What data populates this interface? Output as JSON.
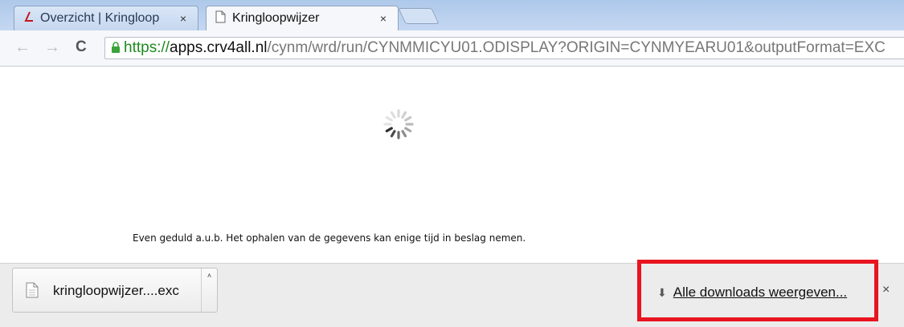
{
  "tabs": [
    {
      "label": "Overzicht | Kringloop",
      "icon": "red-logo-icon",
      "close": "×",
      "active": false
    },
    {
      "label": "Kringloopwijzer",
      "icon": "page-icon",
      "close": "×",
      "active": true
    }
  ],
  "toolbar": {
    "back": "←",
    "forward": "→",
    "reload": "C",
    "url": {
      "scheme": "https://",
      "domain": "apps.crv4all.nl",
      "path": "/cynm/wrd/run/CYNMMICYU01.ODISPLAY?ORIGIN=CYNMYEARU01&outputFormat=EXC"
    }
  },
  "content": {
    "loading_message": "Even geduld a.u.b. Het ophalen van de gegevens kan enige tijd in beslag nemen."
  },
  "download_bar": {
    "item": {
      "filename": "kringloopwijzer....exc",
      "dropdown": "˄"
    },
    "show_all_icon": "⬇",
    "show_all_label": "Alle downloads weergeven...",
    "close": "×",
    "highlight_color": "#e8141f"
  }
}
